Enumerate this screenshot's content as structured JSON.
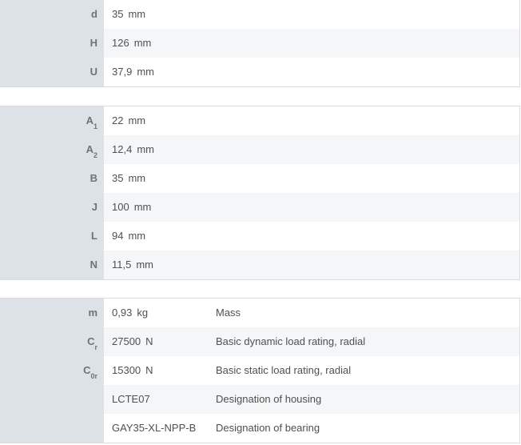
{
  "group1": [
    {
      "sym": "d",
      "sub": "",
      "value": "35",
      "unit": "mm"
    },
    {
      "sym": "H",
      "sub": "",
      "value": "126",
      "unit": "mm"
    },
    {
      "sym": "U",
      "sub": "",
      "value": "37,9",
      "unit": "mm"
    }
  ],
  "group2": [
    {
      "sym": "A",
      "sub": "1",
      "value": "22",
      "unit": "mm"
    },
    {
      "sym": "A",
      "sub": "2",
      "value": "12,4",
      "unit": "mm"
    },
    {
      "sym": "B",
      "sub": "",
      "value": "35",
      "unit": "mm"
    },
    {
      "sym": "J",
      "sub": "",
      "value": "100",
      "unit": "mm"
    },
    {
      "sym": "L",
      "sub": "",
      "value": "94",
      "unit": "mm"
    },
    {
      "sym": "N",
      "sub": "",
      "value": "11,5",
      "unit": "mm"
    }
  ],
  "group3": [
    {
      "sym": "m",
      "sub": "",
      "value": "0,93",
      "unit": "kg",
      "desc": "Mass"
    },
    {
      "sym": "C",
      "sub": "r",
      "value": "27500",
      "unit": "N",
      "desc": "Basic dynamic load rating, radial"
    },
    {
      "sym": "C",
      "sub": "0r",
      "value": "15300",
      "unit": "N",
      "desc": "Basic static load rating, radial"
    },
    {
      "sym": "",
      "sub": "",
      "value": "LCTE07",
      "unit": "",
      "desc": "Designation of housing"
    },
    {
      "sym": "",
      "sub": "",
      "value": "GAY35-XL-NPP-B",
      "unit": "",
      "desc": "Designation of bearing"
    }
  ]
}
